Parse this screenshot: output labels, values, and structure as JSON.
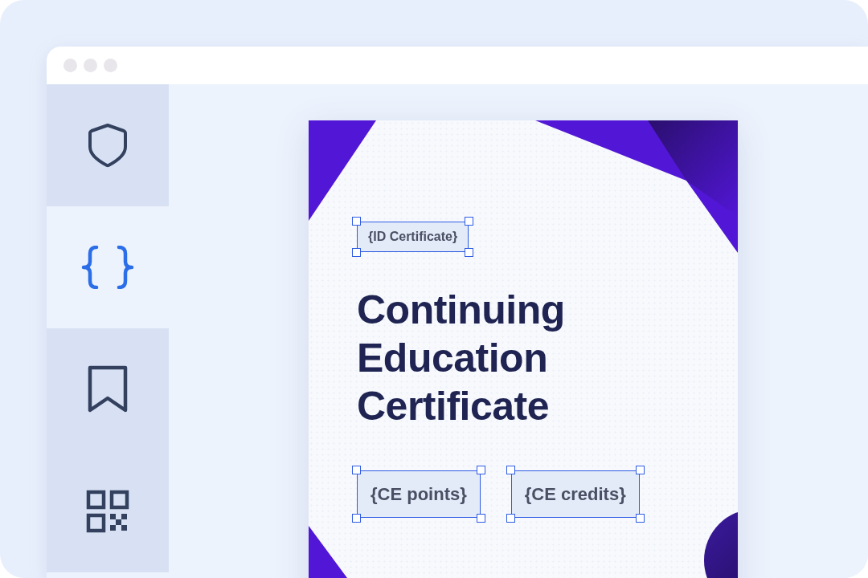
{
  "sidebar": {
    "items": [
      {
        "kind": "shield",
        "selected": false
      },
      {
        "kind": "braces",
        "selected": true
      },
      {
        "kind": "bookmark",
        "selected": false
      },
      {
        "kind": "qr",
        "selected": false
      }
    ]
  },
  "certificate": {
    "id_field": "{ID Certificate}",
    "title": "Continuing Education Certificate",
    "fields": [
      "{CE points}",
      "{CE credits}"
    ]
  }
}
